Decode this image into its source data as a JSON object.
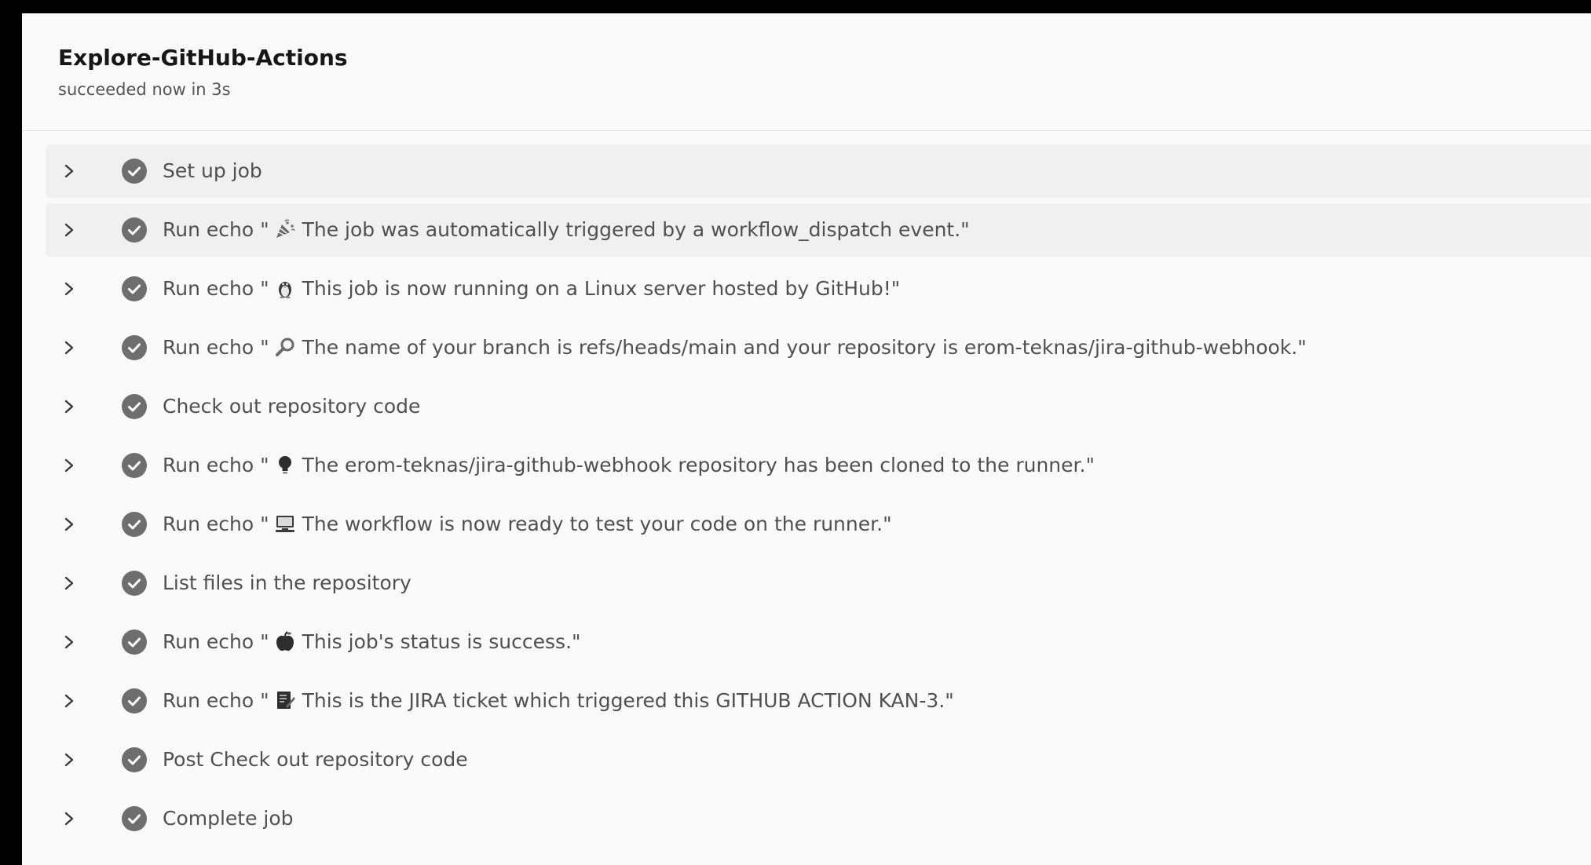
{
  "job": {
    "title": "Explore-GitHub-Actions",
    "subtitle": "succeeded now in 3s"
  },
  "colors": {
    "check_fill": "#6e6e6e",
    "text": "#505050",
    "row_highlight": "#f0f0f0"
  },
  "steps": [
    {
      "prefix": "Set up job",
      "emoji": "",
      "text": ""
    },
    {
      "prefix": "Run echo \"",
      "emoji": "party-popper-icon",
      "text": "The job was automatically triggered by a workflow_dispatch event.\""
    },
    {
      "prefix": "Run echo \"",
      "emoji": "penguin-icon",
      "text": "This job is now running on a Linux server hosted by GitHub!\""
    },
    {
      "prefix": "Run echo \"",
      "emoji": "magnifier-icon",
      "text": "The name of your branch is refs/heads/main and your repository is erom-teknas/jira-github-webhook.\""
    },
    {
      "prefix": "Check out repository code",
      "emoji": "",
      "text": ""
    },
    {
      "prefix": "Run echo \"",
      "emoji": "lightbulb-icon",
      "text": "The erom-teknas/jira-github-webhook repository has been cloned to the runner.\""
    },
    {
      "prefix": "Run echo \"",
      "emoji": "computer-icon",
      "text": "The workflow is now ready to test your code on the runner.\""
    },
    {
      "prefix": "List files in the repository",
      "emoji": "",
      "text": ""
    },
    {
      "prefix": "Run echo \"",
      "emoji": "apple-icon",
      "text": "This job's status is success.\""
    },
    {
      "prefix": "Run echo \"",
      "emoji": "memo-icon",
      "text": "This is the JIRA ticket which triggered this GITHUB ACTION KAN-3.\""
    },
    {
      "prefix": "Post Check out repository code",
      "emoji": "",
      "text": ""
    },
    {
      "prefix": "Complete job",
      "emoji": "",
      "text": ""
    }
  ]
}
